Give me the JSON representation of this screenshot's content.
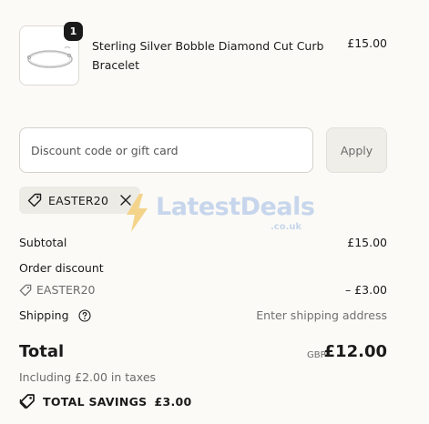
{
  "product": {
    "quantity": "1",
    "name": "Sterling Silver Bobble Diamond Cut Curb Bracelet",
    "price": "£15.00",
    "image_icon": "bracelet-image"
  },
  "discount": {
    "placeholder": "Discount code or gift card",
    "apply_label": "Apply",
    "applied_code": "EASTER20"
  },
  "watermark": {
    "text": "LatestDeals",
    "sub": ".co.uk"
  },
  "summary": {
    "subtotal_label": "Subtotal",
    "subtotal_value": "£15.00",
    "order_discount_label": "Order discount",
    "discount_code": "EASTER20",
    "discount_value": "– £3.00",
    "shipping_label": "Shipping",
    "shipping_value": "Enter shipping address",
    "total_label": "Total",
    "currency": "GBP",
    "total_value": "£12.00",
    "taxes_note": "Including £2.00 in taxes",
    "savings_label": "TOTAL SAVINGS",
    "savings_value": "£3.00"
  },
  "colors": {
    "background": "#fbfaf6",
    "text": "#1a1a1a",
    "muted": "#6b6b6b",
    "chip": "#ecebe6",
    "watermark": "#c7d6ec",
    "watermark_bolt": "#f4d48a"
  }
}
